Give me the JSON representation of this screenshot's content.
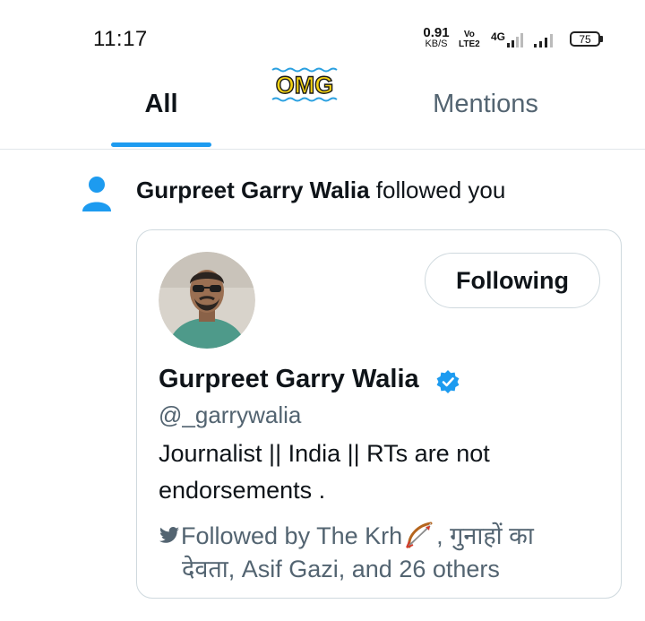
{
  "status_bar": {
    "time": "11:17",
    "net_speed_value": "0.91",
    "net_speed_unit": "KB/S",
    "volte_top": "Vo",
    "volte_bottom": "LTE2",
    "network_type": "4G",
    "battery_level": "75"
  },
  "sticker": {
    "text": "OMG"
  },
  "tabs": [
    {
      "label": "All",
      "selected": true
    },
    {
      "label": "Mentions",
      "selected": false
    }
  ],
  "notification": {
    "icon": "person-icon",
    "actor_name": "Gurpreet Garry Walia",
    "action_text": " followed you",
    "card": {
      "display_name": "Gurpreet Garry Walia",
      "verified": true,
      "handle": "@_garrywalia",
      "follow_button_label": "Following",
      "bio": "Journalist || India || RTs are not endorsements .",
      "followed_by_prefix": "Followed by The Krh",
      "followed_by_suffix": ", गुनाहों का",
      "followed_by_line2": "देवता, Asif Gazi, and 26 others"
    }
  },
  "colors": {
    "accent": "#1d9bf0",
    "text_primary": "#0f1419",
    "text_secondary": "#536471",
    "border": "#cfd9de"
  }
}
